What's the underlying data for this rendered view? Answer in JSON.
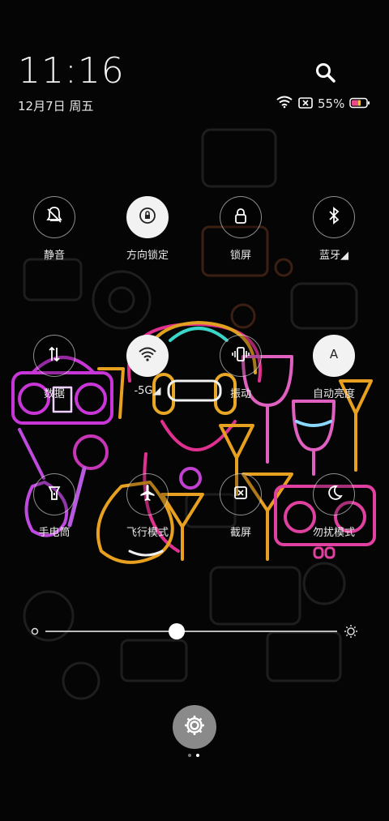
{
  "header": {
    "time": "11:16",
    "date": "12月7日 周五",
    "battery_percent": "55%"
  },
  "tiles": [
    {
      "label": "静音",
      "icon": "bell-off-icon",
      "on": false
    },
    {
      "label": "方向锁定",
      "icon": "rotation-lock-icon",
      "on": true
    },
    {
      "label": "锁屏",
      "icon": "lock-icon",
      "on": false
    },
    {
      "label": "蓝牙◢",
      "icon": "bluetooth-icon",
      "on": false
    },
    {
      "label": "数据",
      "icon": "mobile-data-icon",
      "on": false
    },
    {
      "label": "-5G◢",
      "icon": "wifi-icon",
      "on": true
    },
    {
      "label": "振动",
      "icon": "vibrate-icon",
      "on": false
    },
    {
      "label": "自动亮度",
      "icon": "auto-brightness-icon",
      "on": true
    },
    {
      "label": "手电筒",
      "icon": "flashlight-icon",
      "on": false
    },
    {
      "label": "飞行模式",
      "icon": "airplane-icon",
      "on": false
    },
    {
      "label": "截屏",
      "icon": "screenshot-icon",
      "on": false
    },
    {
      "label": "勿扰模式",
      "icon": "moon-icon",
      "on": false
    }
  ],
  "brightness": {
    "level": 0.45
  },
  "pager": {
    "pages": 2,
    "current": 2
  },
  "colors": {
    "tile_on": "#f2f2f2",
    "battery_fill": "#e84a8a"
  }
}
